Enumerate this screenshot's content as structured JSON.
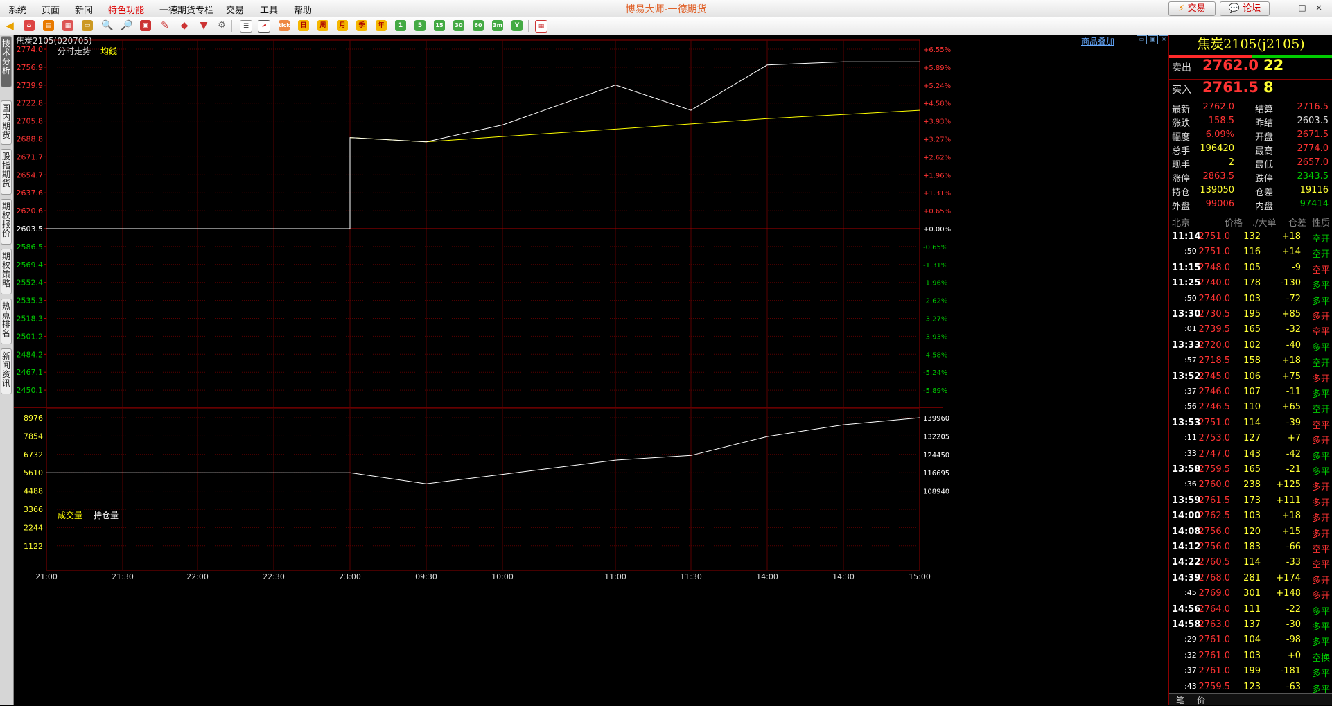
{
  "app_title": "博易大师-一德期货",
  "menu": [
    "系统",
    "页面",
    "新闻",
    "特色功能",
    "一德期货专栏",
    "交易",
    "工具",
    "帮助"
  ],
  "top_buttons": {
    "trade": "交易",
    "forum": "论坛",
    "trade_icon": "lightning-icon",
    "forum_icon": "speech-bubble-icon"
  },
  "window_controls": [
    "_",
    "□",
    "×"
  ],
  "toolbar": {
    "labeled_buttons": [
      "tick",
      "日",
      "周",
      "月",
      "季",
      "年",
      "1",
      "5",
      "15",
      "30",
      "60",
      "3m",
      "Y"
    ]
  },
  "left_tabs": [
    "技术分析",
    "国内期货",
    "股指期货",
    "期权报价",
    "期权策略",
    "热点排名",
    "新闻资讯"
  ],
  "chart": {
    "symbol": "焦炭2105(020705)",
    "overlay_link": "商品叠加",
    "top_label_1": "分时走势",
    "top_label_2": "均线",
    "bottom_label_1": "成交量",
    "bottom_label_2": "持仓量",
    "price_ticks": [
      "2774.0",
      "2756.9",
      "2739.9",
      "2722.8",
      "2705.8",
      "2688.8",
      "2671.7",
      "2654.7",
      "2637.6",
      "2620.6",
      "2603.5",
      "2586.5",
      "2569.4",
      "2552.4",
      "2535.3",
      "2518.3",
      "2501.2",
      "2484.2",
      "2467.1",
      "2450.1"
    ],
    "pct_ticks": [
      "+6.55%",
      "+5.89%",
      "+5.24%",
      "+4.58%",
      "+3.93%",
      "+3.27%",
      "+2.62%",
      "+1.96%",
      "+1.31%",
      "+0.65%",
      "+0.00%",
      "-0.65%",
      "-1.31%",
      "-1.96%",
      "-2.62%",
      "-3.27%",
      "-3.93%",
      "-4.58%",
      "-5.24%",
      "-5.89%"
    ],
    "volume_ticks": [
      "8976",
      "7854",
      "6732",
      "5610",
      "4488",
      "3366",
      "2244",
      "1122"
    ],
    "oi_ticks": [
      "139960",
      "132205",
      "124450",
      "116695",
      "108940"
    ],
    "time_ticks": [
      "21:00",
      "21:30",
      "22:00",
      "22:30",
      "23:00",
      "09:30",
      "10:00",
      "11:00",
      "11:30",
      "14:00",
      "14:30",
      "15:00"
    ],
    "colors": {
      "price_line": "#ffffff",
      "avg_line": "#ffff00",
      "volume": "#ffff00",
      "grid": "#7a0000",
      "up": "#ff3333",
      "down": "#00cc00"
    }
  },
  "chart_data": {
    "type": "line",
    "x": [
      "21:00",
      "21:30",
      "22:00",
      "22:30",
      "23:00",
      "09:30",
      "10:00",
      "11:00",
      "11:30",
      "14:00",
      "14:30",
      "15:00"
    ],
    "prev_settle": 2603.5,
    "ylim": [
      2450.1,
      2774.0
    ],
    "series": [
      {
        "name": "分时走势",
        "values": [
          2603.5,
          2603.5,
          2603.5,
          2603.5,
          2690,
          2686,
          2702,
          2740,
          2716,
          2759,
          2762,
          2762
        ]
      },
      {
        "name": "均线",
        "values": [
          null,
          null,
          null,
          null,
          2690,
          2686,
          2691,
          2698,
          2703,
          2708,
          2712,
          2716
        ]
      },
      {
        "name": "持仓量",
        "values": [
          116695,
          116695,
          116695,
          116695,
          116695,
          112000,
          116000,
          122000,
          124000,
          132000,
          137000,
          139960
        ]
      }
    ]
  },
  "quote": {
    "title": "焦炭2105(j2105)",
    "sell_label": "卖出",
    "sell_price": "2762.0",
    "sell_qty": "22",
    "buy_label": "买入",
    "buy_price": "2761.5",
    "buy_qty": "8",
    "stats": [
      {
        "l1": "最新",
        "v1": "2762.0",
        "c1": "red",
        "l2": "结算",
        "v2": "2716.5",
        "c2": "red"
      },
      {
        "l1": "涨跌",
        "v1": "158.5",
        "c1": "red",
        "l2": "昨结",
        "v2": "2603.5",
        "c2": "white"
      },
      {
        "l1": "幅度",
        "v1": "6.09%",
        "c1": "red",
        "l2": "开盘",
        "v2": "2671.5",
        "c2": "red"
      },
      {
        "l1": "总手",
        "v1": "196420",
        "c1": "yellow",
        "l2": "最高",
        "v2": "2774.0",
        "c2": "red"
      },
      {
        "l1": "现手",
        "v1": "2",
        "c1": "yellow",
        "l2": "最低",
        "v2": "2657.0",
        "c2": "red"
      },
      {
        "l1": "涨停",
        "v1": "2863.5",
        "c1": "red",
        "l2": "跌停",
        "v2": "2343.5",
        "c2": "green"
      },
      {
        "l1": "持仓",
        "v1": "139050",
        "c1": "yellow",
        "l2": "仓差",
        "v2": "19116",
        "c2": "yellow"
      },
      {
        "l1": "外盘",
        "v1": "99006",
        "c1": "red",
        "l2": "内盘",
        "v2": "97414",
        "c2": "green"
      }
    ],
    "tick_header": {
      "time": "北京",
      "price": "价格",
      "vol": "./大单",
      "oi": "仓差",
      "nature": "性质"
    },
    "ticks": [
      {
        "t": "11:14",
        "p": "2751.0",
        "v": "132",
        "o": "+18",
        "n": "空开"
      },
      {
        "t": ":50",
        "p": "2751.0",
        "v": "116",
        "o": "+14",
        "n": "空开"
      },
      {
        "t": "11:15",
        "p": "2748.0",
        "v": "105",
        "o": "-9",
        "n": "空平"
      },
      {
        "t": "11:25",
        "p": "2740.0",
        "v": "178",
        "o": "-130",
        "n": "多平"
      },
      {
        "t": ":50",
        "p": "2740.0",
        "v": "103",
        "o": "-72",
        "n": "多平"
      },
      {
        "t": "13:30",
        "p": "2730.5",
        "v": "195",
        "o": "+85",
        "n": "多开"
      },
      {
        "t": ":01",
        "p": "2739.5",
        "v": "165",
        "o": "-32",
        "n": "空平"
      },
      {
        "t": "13:33",
        "p": "2720.0",
        "v": "102",
        "o": "-40",
        "n": "多平"
      },
      {
        "t": ":57",
        "p": "2718.5",
        "v": "158",
        "o": "+18",
        "n": "空开"
      },
      {
        "t": "13:52",
        "p": "2745.0",
        "v": "106",
        "o": "+75",
        "n": "多开"
      },
      {
        "t": ":37",
        "p": "2746.0",
        "v": "107",
        "o": "-11",
        "n": "多平"
      },
      {
        "t": ":56",
        "p": "2746.5",
        "v": "110",
        "o": "+65",
        "n": "空开"
      },
      {
        "t": "13:53",
        "p": "2751.0",
        "v": "114",
        "o": "-39",
        "n": "空平"
      },
      {
        "t": ":11",
        "p": "2753.0",
        "v": "127",
        "o": "+7",
        "n": "多开"
      },
      {
        "t": ":33",
        "p": "2747.0",
        "v": "143",
        "o": "-42",
        "n": "多平"
      },
      {
        "t": "13:58",
        "p": "2759.5",
        "v": "165",
        "o": "-21",
        "n": "多平"
      },
      {
        "t": ":36",
        "p": "2760.0",
        "v": "238",
        "o": "+125",
        "n": "多开"
      },
      {
        "t": "13:59",
        "p": "2761.5",
        "v": "173",
        "o": "+111",
        "n": "多开"
      },
      {
        "t": "14:00",
        "p": "2762.5",
        "v": "103",
        "o": "+18",
        "n": "多开"
      },
      {
        "t": "14:08",
        "p": "2756.0",
        "v": "120",
        "o": "+15",
        "n": "多开"
      },
      {
        "t": "14:12",
        "p": "2756.0",
        "v": "183",
        "o": "-66",
        "n": "空平"
      },
      {
        "t": "14:22",
        "p": "2760.5",
        "v": "114",
        "o": "-33",
        "n": "空平"
      },
      {
        "t": "14:39",
        "p": "2768.0",
        "v": "281",
        "o": "+174",
        "n": "多开"
      },
      {
        "t": ":45",
        "p": "2769.0",
        "v": "301",
        "o": "+148",
        "n": "多开"
      },
      {
        "t": "14:56",
        "p": "2764.0",
        "v": "111",
        "o": "-22",
        "n": "多平"
      },
      {
        "t": "14:58",
        "p": "2763.0",
        "v": "137",
        "o": "-30",
        "n": "多平"
      },
      {
        "t": ":29",
        "p": "2761.0",
        "v": "104",
        "o": "-98",
        "n": "多平"
      },
      {
        "t": ":32",
        "p": "2761.0",
        "v": "103",
        "o": "+0",
        "n": "空换"
      },
      {
        "t": ":37",
        "p": "2761.0",
        "v": "199",
        "o": "-181",
        "n": "多平"
      },
      {
        "t": ":43",
        "p": "2759.5",
        "v": "123",
        "o": "-63",
        "n": "多平"
      }
    ],
    "bottom_tabs": [
      "笔",
      "价"
    ]
  }
}
